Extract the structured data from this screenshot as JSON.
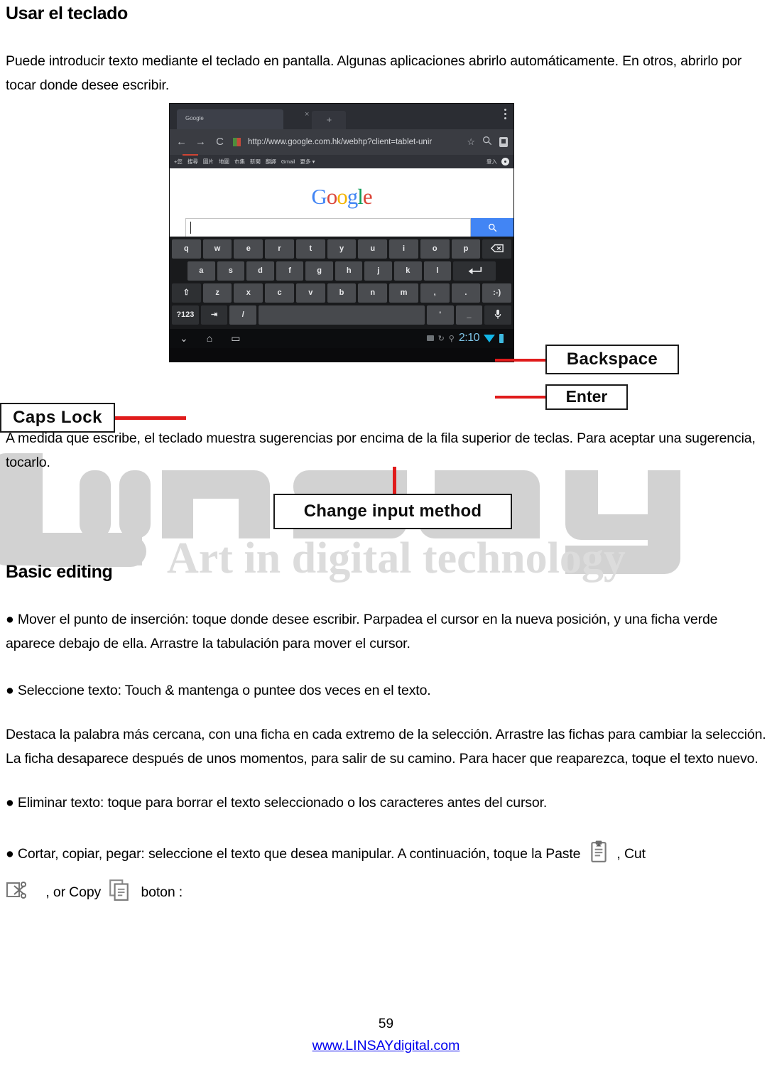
{
  "document": {
    "heading1": "Usar el teclado",
    "intro": "Puede introducir texto mediante el teclado en pantalla. Algunas aplicaciones abrirlo automáticamente. En otros, abrirlo por tocar donde desee escribir.",
    "after_figure": "A medida que escribe, el teclado muestra sugerencias por encima de la fila superior de teclas. Para aceptar una sugerencia, tocarlo.",
    "heading2": "Basic editing",
    "bullet1": "● Mover el punto de inserción: toque donde desee escribir. Parpadea el cursor en la nueva posición, y una ficha verde aparece debajo de ella. Arrastre la tabulación para mover el cursor.",
    "bullet2": "●  Seleccione texto: Touch & mantenga o puntee dos veces en el texto.",
    "paragraph3": "Destaca la palabra más cercana, con una ficha en cada extremo de la selección. Arrastre las fichas para cambiar la selección. La ficha desaparece después de unos momentos, para salir de su camino. Para hacer que reaparezca, toque el texto nuevo.",
    "bullet3": "● Eliminar texto: toque para borrar el texto seleccionado o los caracteres antes del cursor.",
    "bullet4_part1": "● Cortar, copiar, pegar: seleccione el texto que desea manipular. A continuación, toque la Paste",
    "bullet4_part2": ", Cut",
    "bullet4_part3": ", or Copy",
    "bullet4_part4": "boton :"
  },
  "callouts": {
    "caps_lock": "Caps Lock",
    "backspace": "Backspace",
    "enter": "Enter",
    "change_input_method": "Change input method"
  },
  "tablet": {
    "browser": {
      "tab_title": "Google",
      "tab_close": "×",
      "tab_new": "+",
      "url": "http://www.google.com.hk/webhp?client=tablet-unir",
      "nav_back": "←",
      "nav_forward": "→",
      "nav_reload": "C",
      "bookmark_star": "☆",
      "search_icon": "search-icon"
    },
    "google_nav": {
      "items": [
        "+您",
        "搜尋",
        "圖片",
        "地圖",
        "市集",
        "新聞",
        "翻譯",
        "Gmail",
        "更多 ▾"
      ],
      "right_label": "登入"
    },
    "logo": {
      "g1": "G",
      "o1": "o",
      "o2": "o",
      "g2": "g",
      "l": "l",
      "e": "e"
    },
    "keyboard": {
      "row1": [
        "q",
        "w",
        "e",
        "r",
        "t",
        "y",
        "u",
        "i",
        "o",
        "p"
      ],
      "row1_extra": "backspace-key",
      "row2": [
        "a",
        "s",
        "d",
        "f",
        "g",
        "h",
        "j",
        "k",
        "l"
      ],
      "row2_extra": "enter-key",
      "row3_shift": "⇧",
      "row3": [
        "z",
        "x",
        "c",
        "v",
        "b",
        "n",
        "m",
        ",",
        ".",
        ":-)"
      ],
      "row4_numeric": "?123",
      "row4_tab": "⇥",
      "row4_slash": "/",
      "row4_space": "",
      "row4_apos": "'",
      "row4_dot": "_",
      "row4_mic": "mic-key"
    },
    "system_bar": {
      "back": "⌄",
      "home": "⌂",
      "recents": "▭",
      "clock": "2:10",
      "wifi": "wifi-icon",
      "battery": "battery-icon"
    }
  },
  "watermark": {
    "brand": "LINSAY",
    "tagline": "Art in digital technology"
  },
  "footer": {
    "page_number": "59",
    "url": "www.LINSAYdigital.com"
  },
  "colors": {
    "callout_line": "#e01b1b",
    "link": "#0000EE",
    "watermark": "#d2d2d2",
    "google_blue": "#4285F4",
    "google_red": "#DB4437",
    "google_yellow": "#F4B400",
    "google_green": "#0F9D58"
  }
}
